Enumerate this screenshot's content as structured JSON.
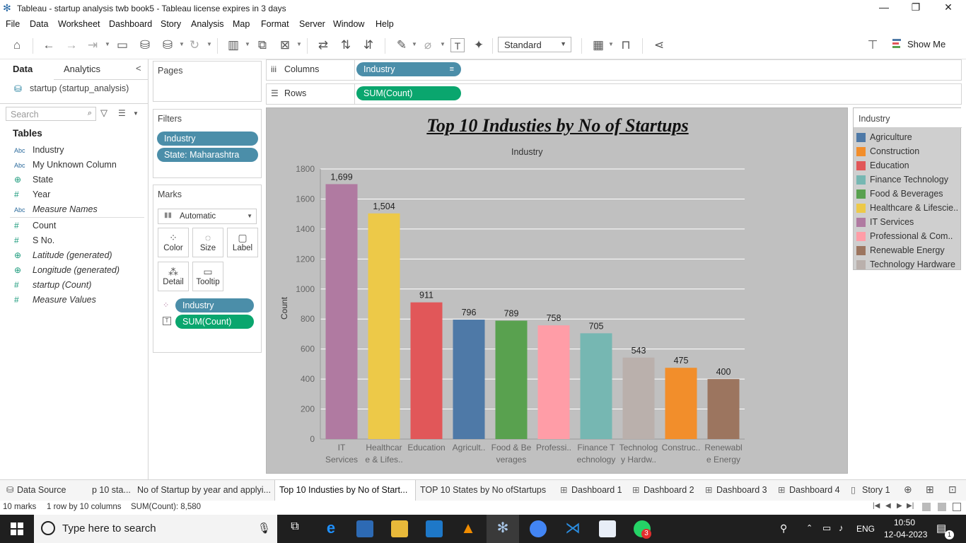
{
  "window": {
    "title": "Tableau - startup analysis twb book5 - Tableau license expires in 3 days",
    "min": "—",
    "max": "❐",
    "close": "✕"
  },
  "menu": [
    "File",
    "Data",
    "Worksheet",
    "Dashboard",
    "Story",
    "Analysis",
    "Map",
    "Format",
    "Server",
    "Window",
    "Help"
  ],
  "toolbar": {
    "fit_label": "Standard",
    "show_me": "Show Me"
  },
  "data_pane": {
    "tab_data": "Data",
    "tab_analytics": "Analytics",
    "collapse": "<",
    "datasource": "startup (startup_analysis)",
    "search_placeholder": "Search",
    "tables_heading": "Tables",
    "dimensions": [
      {
        "type": "Abc",
        "name": "Industry"
      },
      {
        "type": "Abc",
        "name": "My Unknown Column"
      },
      {
        "type": "geo",
        "name": "State"
      },
      {
        "type": "#",
        "name": "Year"
      },
      {
        "type": "Abc",
        "name": "Measure Names"
      }
    ],
    "measures": [
      {
        "type": "#",
        "name": "Count"
      },
      {
        "type": "#",
        "name": "S No."
      },
      {
        "type": "geo",
        "name": "Latitude (generated)"
      },
      {
        "type": "geo",
        "name": "Longitude (generated)"
      },
      {
        "type": "#",
        "name": "startup (Count)"
      },
      {
        "type": "#",
        "name": "Measure Values"
      }
    ]
  },
  "pages": {
    "title": "Pages"
  },
  "filters": {
    "title": "Filters",
    "items": [
      "Industry",
      "State: Maharashtra"
    ]
  },
  "marks": {
    "title": "Marks",
    "type": "Automatic",
    "buttons": [
      "Color",
      "Size",
      "Label",
      "Detail",
      "Tooltip"
    ],
    "pills": [
      "Industry",
      "SUM(Count)"
    ]
  },
  "shelves": {
    "columns_label": "Columns",
    "columns_pill": "Industry",
    "rows_label": "Rows",
    "rows_pill": "SUM(Count)"
  },
  "viz": {
    "title": "Top 10 Industies by No of Startups ",
    "header": "Industry"
  },
  "chart_data": {
    "type": "bar",
    "title": "Top 10 Industies by No of Startups",
    "xlabel": "Industry",
    "ylabel": "Count",
    "ylim": [
      0,
      1800
    ],
    "yticks": [
      0,
      200,
      400,
      600,
      800,
      1000,
      1200,
      1400,
      1600,
      1800
    ],
    "grid": true,
    "categories": [
      "IT Services",
      "Healthcare & Lifes..",
      "Education",
      "Agricult..",
      "Food & Beverages",
      "Professi..",
      "Finance Technology",
      "Technology Hardw..",
      "Construc..",
      "Renewable Energy"
    ],
    "tick_labels": [
      [
        "IT",
        "Services"
      ],
      [
        "Healthcar",
        "e & Lifes.."
      ],
      [
        "Education"
      ],
      [
        "Agricult.."
      ],
      [
        "Food & Be",
        "verages"
      ],
      [
        "Professi.."
      ],
      [
        "Finance T",
        "echnology"
      ],
      [
        "Technolog",
        "y Hardw.."
      ],
      [
        "Construc.."
      ],
      [
        "Renewabl",
        "e Energy"
      ]
    ],
    "values": [
      1699,
      1504,
      911,
      796,
      789,
      758,
      705,
      543,
      475,
      400
    ],
    "value_labels": [
      "1,699",
      "1,504",
      "911",
      "796",
      "789",
      "758",
      "705",
      "543",
      "475",
      "400"
    ],
    "colors": [
      "#b07aa1",
      "#edc948",
      "#e15759",
      "#4e79a7",
      "#59a14f",
      "#ff9da7",
      "#76b7b2",
      "#bab0ac",
      "#f28e2b",
      "#9c755f"
    ]
  },
  "legend": {
    "title": "Industry",
    "items": [
      {
        "label": "Agriculture",
        "color": "#4e79a7"
      },
      {
        "label": "Construction",
        "color": "#f28e2b"
      },
      {
        "label": "Education",
        "color": "#e15759"
      },
      {
        "label": "Finance Technology",
        "color": "#76b7b2"
      },
      {
        "label": "Food & Beverages",
        "color": "#59a14f"
      },
      {
        "label": "Healthcare & Lifescie..",
        "color": "#edc948"
      },
      {
        "label": "IT Services",
        "color": "#b07aa1"
      },
      {
        "label": "Professional & Com..",
        "color": "#ff9da7"
      },
      {
        "label": "Renewable Energy",
        "color": "#9c755f"
      },
      {
        "label": "Technology Hardware",
        "color": "#bab0ac"
      }
    ]
  },
  "sheet_tabs": {
    "data_source": "Data Source",
    "tabs": [
      "p 10 sta...",
      "No of Startup by year and applyi...",
      "Top 10 Industies by No of Start...",
      "TOP 10 States by No ofStartups",
      "Dashboard 1",
      "Dashboard 2",
      "Dashboard 3",
      "Dashboard 4",
      "Story 1"
    ]
  },
  "status": {
    "marks": "10 marks",
    "rows": "1 row by 10 columns",
    "sum": "SUM(Count): 8,580"
  },
  "taskbar": {
    "search_placeholder": "Type here to search",
    "lang": "ENG",
    "time": "10:50",
    "date": "12-04-2023",
    "whatsapp_badge": "3",
    "notif_badge": "1"
  }
}
